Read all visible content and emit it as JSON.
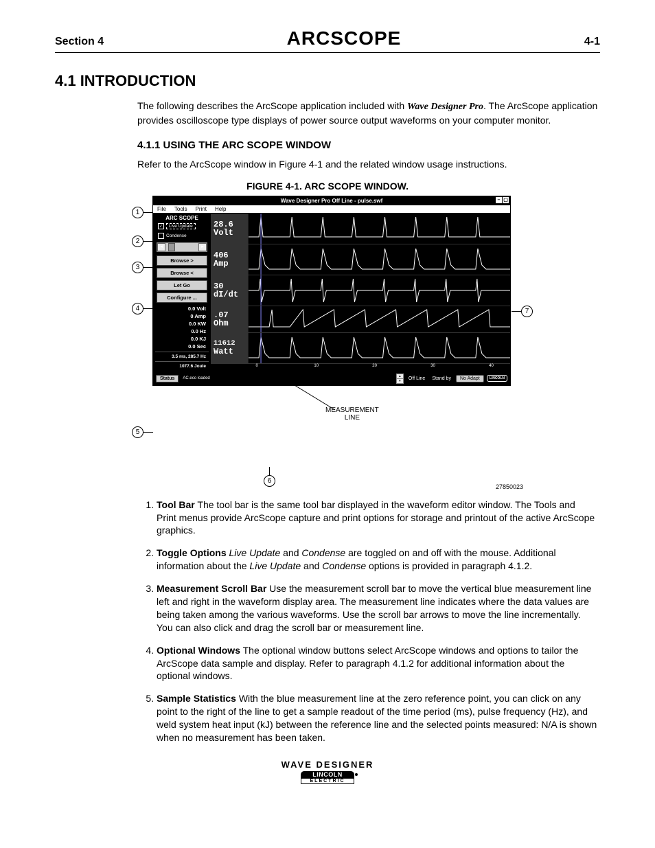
{
  "header": {
    "left": "Section 4",
    "center": "ARCSCOPE",
    "right": "4-1"
  },
  "title_41": "4.1  INTRODUCTION",
  "intro_a": "The following describes the ArcScope application included with ",
  "intro_brand": "Wave Designer Pro",
  "intro_b": ". The ArcScope application provides oscilloscope type displays of power source output waveforms on your computer monitor.",
  "subsection_411": "4.1.1  USING THE ARC SCOPE WINDOW",
  "sub_body": "Refer to the ArcScope window in Figure 4-1 and the related window usage instructions.",
  "figure_caption": "FIGURE 4-1.  ARC SCOPE WINDOW.",
  "figure_id": "27850023",
  "measurement_label_1": "MEASUREMENT",
  "measurement_label_2": "LINE",
  "callouts": {
    "1": "1",
    "2": "2",
    "3": "3",
    "4": "4",
    "5": "5",
    "6": "6",
    "7": "7"
  },
  "scope": {
    "titlebar": "Wave Designer Pro Off Line - pulse.swf",
    "menu": [
      "File",
      "Tools",
      "Print",
      "Help"
    ],
    "panel_title": "ARC SCOPE",
    "toggles": {
      "live_update": "Live Update",
      "condense": "Condense"
    },
    "buttons": {
      "browse_fwd": "Browse  >",
      "browse_back": "Browse  <",
      "let_go": "Let Go",
      "configure": "Configure ..."
    },
    "side_stats": [
      "0.0 Volt",
      "0 Amp",
      "0.0 KW",
      "0.0 Hz",
      "0.0 KJ",
      "0.0 Sec",
      "3.5 ms, 285.7 Hz",
      "1077.6 Joule"
    ],
    "readings": [
      {
        "value": "28.6",
        "unit": "Volt"
      },
      {
        "value": "406",
        "unit": "Amp"
      },
      {
        "value": "30",
        "unit": "dI/dt"
      },
      {
        "value": ".07",
        "unit": "Ohm"
      },
      {
        "value": "11612",
        "unit": "Watt"
      }
    ],
    "xticks": [
      "0",
      "10",
      "20",
      "30",
      "40"
    ],
    "status": {
      "label": "Status",
      "text": "AC.eco loaded",
      "offline": "Off Line",
      "standby": "Stand by",
      "noadapt": "No Adapt",
      "brand": "LINCOLN"
    }
  },
  "list": [
    {
      "title": "Tool Bar",
      "body": "  The tool bar is the same tool bar displayed in the waveform editor window. The Tools and Print menus provide ArcScope capture and print options  for storage and printout of the active ArcScope graphics."
    },
    {
      "title": "Toggle Options",
      "body_a": "  ",
      "i1": "Live Update",
      "body_b": " and ",
      "i2": "Condense",
      "body_c": " are toggled on and off with the mouse. Additional information about the ",
      "i3": "Live Update",
      "body_d": " and ",
      "i4": "Condense",
      "body_e": " options is provided in paragraph 4.1.2."
    },
    {
      "title": "Measurement Scroll Bar",
      "body": "  Use the measurement scroll bar to move the vertical blue measurement line left and right in the waveform display area. The measurement line indicates where the data values are being taken among the various waveforms. Use the scroll bar arrows to move the line incrementally. You can also click and drag the scroll bar or measurement line."
    },
    {
      "title": "Optional Windows",
      "body": "  The optional window buttons select ArcScope windows and options to tailor the ArcScope data sample and display. Refer to paragraph 4.1.2 for additional information about the optional windows."
    },
    {
      "title": "Sample Statistics",
      "body": "  With the blue measurement line at the zero reference point, you can click on any point to the right of the line to get a sample readout of the time period (ms), pulse frequency (Hz), and weld system heat input (kJ) between the reference line and the selected points measured: N/A is shown when no measurement has been taken."
    }
  ],
  "footer": {
    "wd": "WAVE  DESIGNER",
    "logo_top": "LINCOLN",
    "logo_bot": "ELECTRIC"
  },
  "chart_data": {
    "type": "line",
    "note": "Five stacked oscilloscope traces (Volt, Amp, dI/dt, Ohm, Watt) vs time 0–40 ms. Traces are periodic pulse spikes; exact y-values read from live-update boxes, waveform shapes approximated.",
    "x_range_ms": [
      0,
      45
    ],
    "series": [
      {
        "name": "Volt",
        "reading": 28.6
      },
      {
        "name": "Amp",
        "reading": 406
      },
      {
        "name": "dI/dt",
        "reading": 30
      },
      {
        "name": "Ohm",
        "reading": 0.07
      },
      {
        "name": "Watt",
        "reading": 11612
      }
    ],
    "xticks": [
      0,
      10,
      20,
      30,
      40
    ]
  }
}
